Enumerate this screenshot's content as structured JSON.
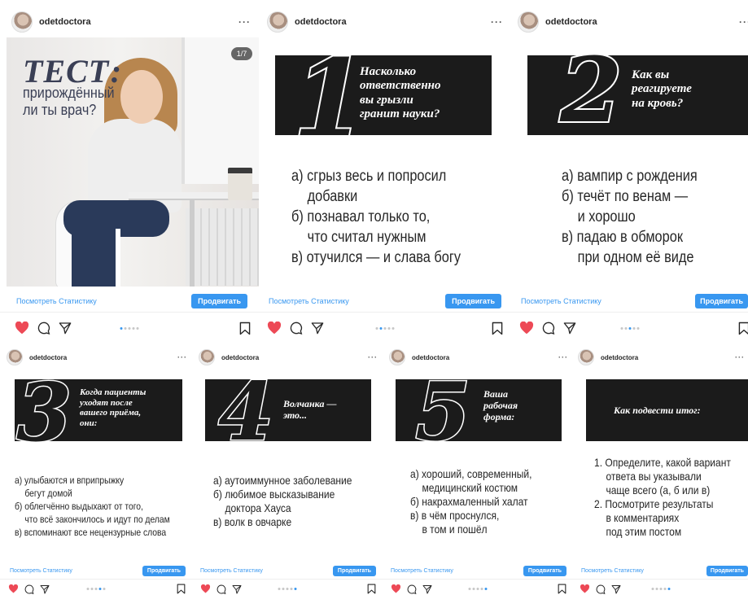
{
  "username": "odetdoctora",
  "more": "···",
  "stats_label": "Посмотреть Статистику",
  "promote_label": "Продвигать",
  "colors": {
    "accent": "#3897f0",
    "like": "#ed4956",
    "card": "#1b1b1b"
  },
  "icons": [
    "heart-icon",
    "comment-icon",
    "share-icon",
    "bookmark-icon"
  ],
  "posts": [
    {
      "type": "photo",
      "pager": "1/7",
      "title": "ТЕСТ:",
      "subtitle": [
        "прирождённый",
        "ли ты врач?"
      ]
    },
    {
      "type": "question",
      "number": "1",
      "question": [
        "Насколько",
        "ответственно",
        "вы грызли",
        "гранит науки?"
      ],
      "answers": [
        "а) сгрыз весь и попросил",
        "добавки",
        "б) познавал только то,",
        "что считал нужным",
        "в) отучился — и слава богу"
      ]
    },
    {
      "type": "question",
      "number": "2",
      "question": [
        "Как вы",
        "реагируете",
        "на кровь?"
      ],
      "answers": [
        "а) вампир с рождения",
        "б) течёт по венам —",
        "и хорошо",
        "в) падаю в обморок",
        "при одном её виде"
      ]
    },
    {
      "type": "question",
      "number": "3",
      "question": [
        "Когда пациенты",
        "уходят после",
        "вашего приёма,",
        "они:"
      ],
      "answers": [
        "а) улыбаются и вприпрыжку",
        "бегут домой",
        "б) облегчённо выдыхают от того,",
        "что всё закончилось и идут по делам",
        "в) вспоминают все нецензурные слова"
      ]
    },
    {
      "type": "question",
      "number": "4",
      "question": [
        "Волчанка —",
        "это..."
      ],
      "answers": [
        "а) аутоиммунное заболевание",
        "б) любимое высказывание",
        "доктора Хауса",
        "в) волк в овчарке"
      ]
    },
    {
      "type": "question",
      "number": "5",
      "question": [
        "Ваша",
        "рабочая",
        "форма:"
      ],
      "answers": [
        "а) хороший, современный,",
        "медицинский костюм",
        "б) накрахмаленный халат",
        "в) в чём проснулся,",
        "в том и пошёл"
      ]
    },
    {
      "type": "summary",
      "question": [
        "Как подвести итог:"
      ],
      "answers": [
        "1. Определите, какой вариант",
        "ответа вы указывали",
        "чаще всего (а, б или в)",
        "2. Посмотрите результаты",
        "в комментариях",
        "под этим постом"
      ]
    }
  ]
}
